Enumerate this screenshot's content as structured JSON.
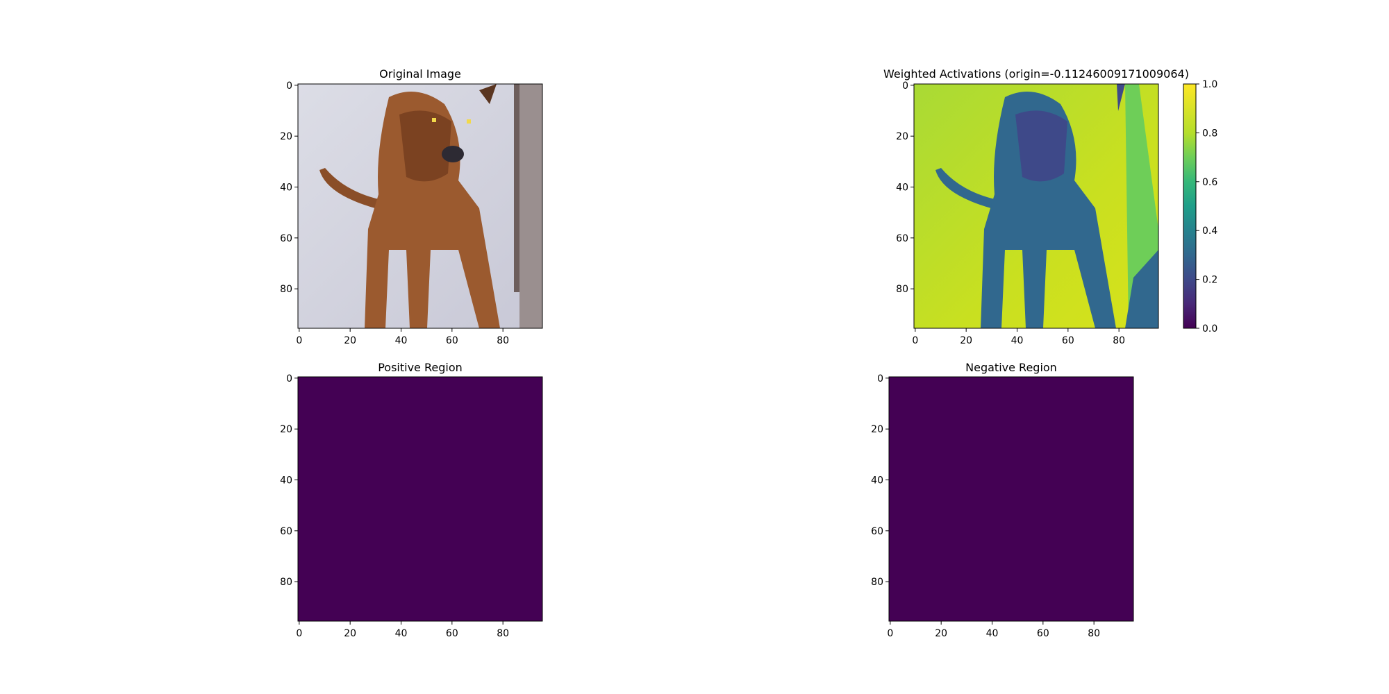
{
  "chart_data": [
    {
      "type": "heatmap",
      "title": "Original Image",
      "fill": "image-photo",
      "xlim": [
        0,
        96
      ],
      "ylim": [
        96,
        0
      ],
      "xticks": [
        0,
        20,
        40,
        60,
        80
      ],
      "yticks": [
        0,
        20,
        40,
        60,
        80
      ]
    },
    {
      "type": "heatmap",
      "title": "Weighted Activations (origin=-0.11246009171009064)",
      "fill": "viridis-activation-map",
      "xlim": [
        0,
        96
      ],
      "ylim": [
        96,
        0
      ],
      "xticks": [
        0,
        20,
        40,
        60,
        80
      ],
      "yticks": [
        0,
        20,
        40,
        60,
        80
      ],
      "colorbar": {
        "colormap": "viridis",
        "range": [
          0.0,
          1.0
        ],
        "ticks": [
          0.0,
          0.2,
          0.4,
          0.6,
          0.8,
          1.0
        ],
        "tick_labels": [
          "0.0",
          "0.2",
          "0.4",
          "0.6",
          "0.8",
          "1.0"
        ]
      }
    },
    {
      "type": "heatmap",
      "title": "Positive Region",
      "fill": "uniform",
      "fill_color": "#440154",
      "xlim": [
        0,
        96
      ],
      "ylim": [
        96,
        0
      ],
      "xticks": [
        0,
        20,
        40,
        60,
        80
      ],
      "yticks": [
        0,
        20,
        40,
        60,
        80
      ]
    },
    {
      "type": "heatmap",
      "title": "Negative Region",
      "fill": "uniform",
      "fill_color": "#440154",
      "xlim": [
        0,
        96
      ],
      "ylim": [
        96,
        0
      ],
      "xticks": [
        0,
        20,
        40,
        60,
        80
      ],
      "yticks": [
        0,
        20,
        40,
        60,
        80
      ]
    }
  ]
}
